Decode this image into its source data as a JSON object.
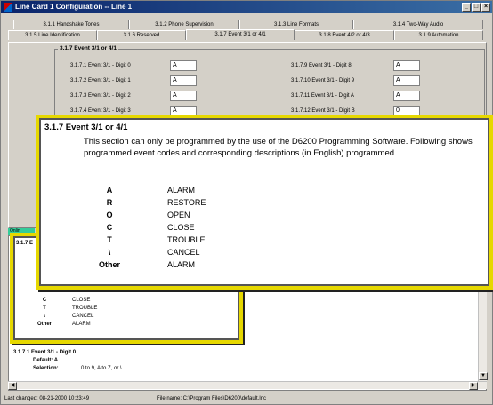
{
  "window": {
    "title": "Line Card 1 Configuration  --  Line 1",
    "buttons": {
      "minimize": "_",
      "maximize": "□",
      "close": "×"
    }
  },
  "tabs_row1": [
    "3.1.1 Handshake Tones",
    "3.1.2 Phone Supervision",
    "3.1.3 Line Formats",
    "3.1.4 Two-Way Audio"
  ],
  "tabs_row2": [
    "3.1.5 Line Identification",
    "3.1.6 Reserved",
    "3.1.7 Event 3/1 or 4/1",
    "3.1.8 Event 4/2 or 4/3",
    "3.1.9 Automation"
  ],
  "group": {
    "title": "3.1.7 Event 3/1 or 4/1",
    "left_fields": [
      {
        "label": "3.1.7.1 Event 3/1 - Digit 0",
        "value": "A"
      },
      {
        "label": "3.1.7.2 Event 3/1 - Digit 1",
        "value": "A"
      },
      {
        "label": "3.1.7.3 Event 3/1 - Digit 2",
        "value": "A"
      },
      {
        "label": "3.1.7.4 Event 3/1 - Digit 3",
        "value": "A"
      }
    ],
    "right_fields": [
      {
        "label": "3.1.7.9 Event 3/1 - Digit 8",
        "value": "A"
      },
      {
        "label": "3.1.7.10 Event 3/1 - Digit 9",
        "value": "A"
      },
      {
        "label": "3.1.7.11 Event 3/1 - Digit A",
        "value": "A"
      },
      {
        "label": "3.1.7.12 Event 3/1 - Digit B",
        "value": "0"
      }
    ]
  },
  "lower": {
    "tab_label": "Onlin",
    "header_fragment": "3.1.7 E",
    "small_codes": [
      {
        "code": "C",
        "desc": "CLOSE"
      },
      {
        "code": "T",
        "desc": "TROUBLE"
      },
      {
        "code": "\\",
        "desc": "CANCEL"
      },
      {
        "code": "Other",
        "desc": "ALARM"
      }
    ],
    "detail_title": "3.1.7.1 Event 3/1 - Digit 0",
    "detail_default": "Default: A",
    "detail_selection_label": "Selection:",
    "detail_selection_value": "0 to 9, A to Z, or \\"
  },
  "popup": {
    "heading": "3.1.7 Event 3/1 or 4/1",
    "text": "This section can only be programmed by the use of the D6200 Programming Software. Following shows programmed event codes and corresponding descriptions (in English) programmed.",
    "codes": [
      {
        "code": "A",
        "desc": "ALARM"
      },
      {
        "code": "R",
        "desc": "RESTORE"
      },
      {
        "code": "O",
        "desc": "OPEN"
      },
      {
        "code": "C",
        "desc": "CLOSE"
      },
      {
        "code": "T",
        "desc": "TROUBLE"
      },
      {
        "code": "\\",
        "desc": "CANCEL"
      },
      {
        "code": "Other",
        "desc": "ALARM"
      }
    ]
  },
  "status": {
    "last_changed": "Last changed: 08-21-2000 10:23:49",
    "file_name": "File name: C:\\Program Files\\D6200\\default.lnc"
  }
}
